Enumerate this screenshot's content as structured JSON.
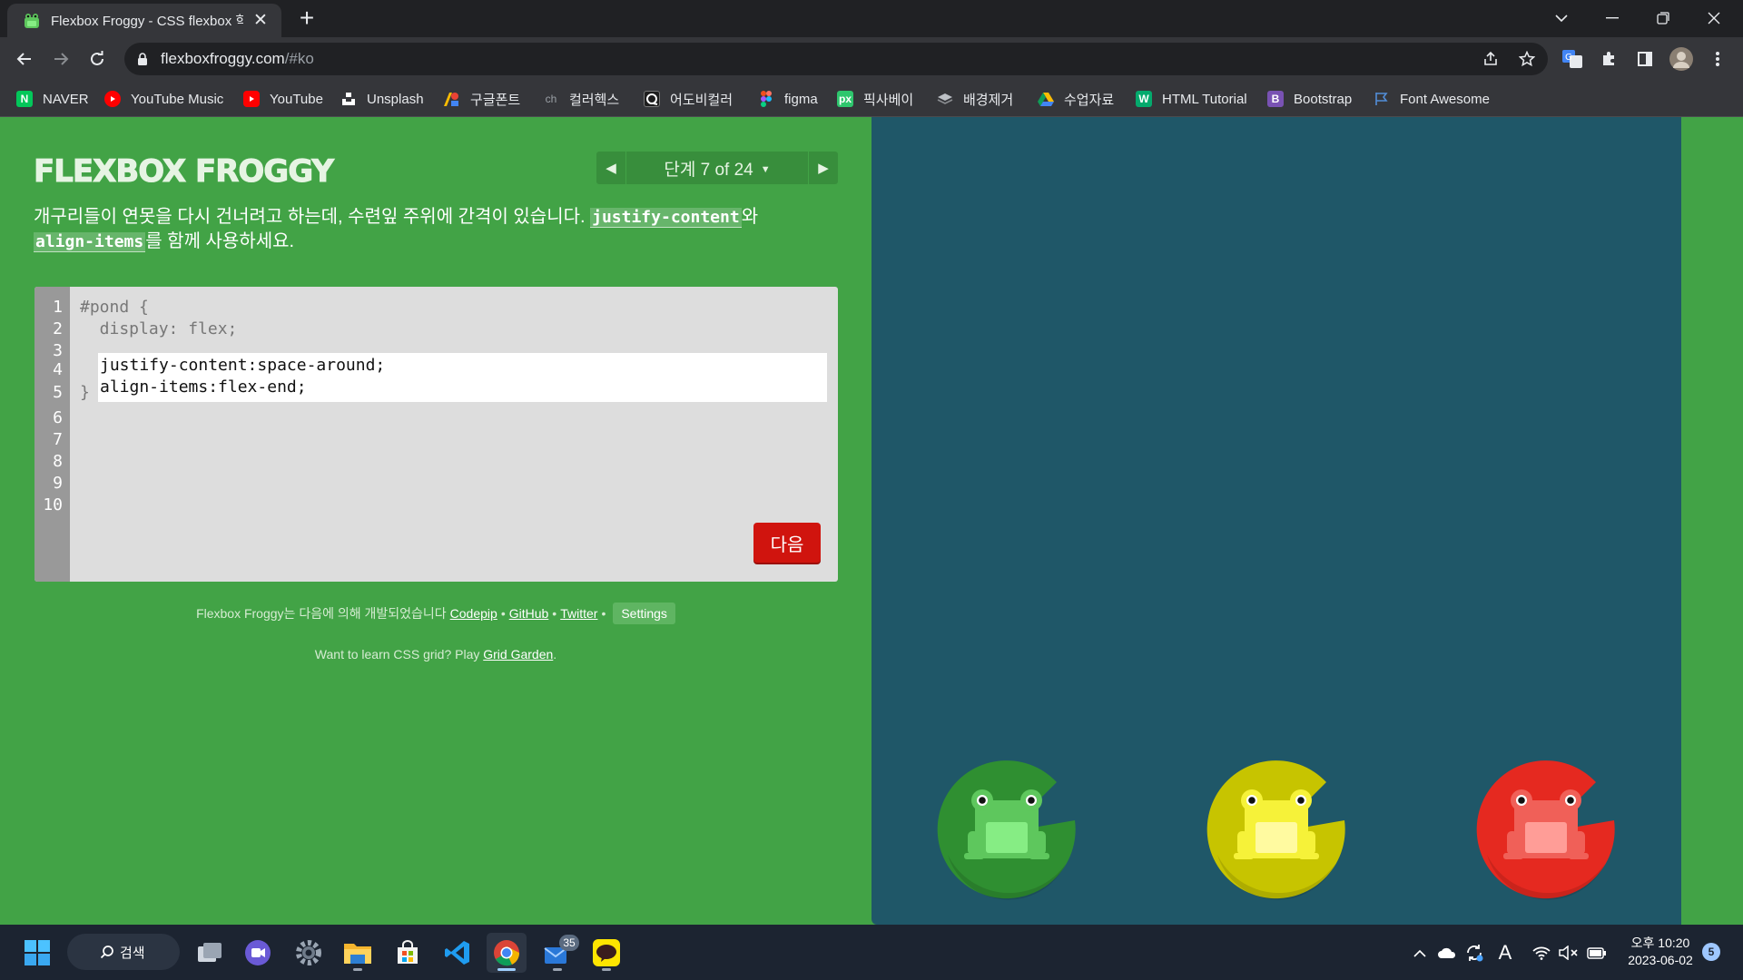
{
  "browser": {
    "tab_title": "Flexbox Froggy - CSS flexbox 학",
    "url_host": "flexboxfroggy.com",
    "url_path": "/#ko",
    "bookmarks": [
      {
        "label": "NAVER",
        "icon": "naver-icon",
        "color": "#03c75a",
        "glyph": "N"
      },
      {
        "label": "YouTube Music",
        "icon": "youtube-music-icon",
        "color": "#ff0000",
        "glyph": ""
      },
      {
        "label": "YouTube",
        "icon": "youtube-icon",
        "color": "#ff0000",
        "glyph": ""
      },
      {
        "label": "Unsplash",
        "icon": "unsplash-icon",
        "color": "#ffffff",
        "glyph": ""
      },
      {
        "label": "구글폰트",
        "icon": "google-fonts-icon",
        "color": "#4285f4",
        "glyph": ""
      },
      {
        "label": "컬러헥스",
        "icon": "colorhex-icon",
        "color": "#35363a",
        "glyph": "ch"
      },
      {
        "label": "어도비컬러",
        "icon": "adobe-color-icon",
        "color": "#1e1e1e",
        "glyph": ""
      },
      {
        "label": "figma",
        "icon": "figma-icon",
        "color": "#f24e1e",
        "glyph": ""
      },
      {
        "label": "픽사베이",
        "icon": "pixabay-icon",
        "color": "#2ec66d",
        "glyph": "px"
      },
      {
        "label": "배경제거",
        "icon": "remove-bg-icon",
        "color": "#9aa0a6",
        "glyph": ""
      },
      {
        "label": "수업자료",
        "icon": "google-drive-icon",
        "color": "#fbbc04",
        "glyph": ""
      },
      {
        "label": "HTML Tutorial",
        "icon": "w3schools-icon",
        "color": "#04aa6d",
        "glyph": "W"
      },
      {
        "label": "Bootstrap",
        "icon": "bootstrap-icon",
        "color": "#7952b3",
        "glyph": "B"
      },
      {
        "label": "Font Awesome",
        "icon": "font-awesome-icon",
        "color": "#528dd7",
        "glyph": ""
      }
    ]
  },
  "game": {
    "logo": "FLEXBOX FROGGY",
    "level_label": "단계 7 of 24",
    "level_current": 7,
    "level_total": 24,
    "instructions_before": "개구리들이 연못을 다시 건너려고 하는데, 수련잎 주위에 간격이 있습니다. ",
    "code_term_1": "justify-content",
    "instructions_mid": "와",
    "code_term_2": "align-items",
    "instructions_after": "를 함께 사용하세요.",
    "line_numbers": [
      "1",
      "2",
      "3",
      "4",
      "5",
      "6",
      "7",
      "8",
      "9",
      "10"
    ],
    "code_line_1": "#pond {",
    "code_line_2": "  display: flex;",
    "code_line_5": "}",
    "user_input": "justify-content:space-around;\nalign-items:flex-end;",
    "next_button": "다음",
    "credits_text": "Flexbox Froggy는 다음에 의해 개발되었습니다",
    "credit_codepip": "Codepip",
    "credit_github": "GitHub",
    "credit_twitter": "Twitter",
    "bullet": "•",
    "settings_button": "Settings",
    "grid_text_before": "Want to learn CSS grid? Play ",
    "grid_link": "Grid Garden",
    "grid_text_after": "."
  },
  "pond": {
    "background": "#1f5768",
    "frogs": [
      {
        "color": "green",
        "pad": "#2f8f31",
        "body": "#5ec75d",
        "belly": "#86ed84"
      },
      {
        "color": "yellow",
        "pad": "#c7c400",
        "body": "#f6f239",
        "belly": "#fffaa0"
      },
      {
        "color": "red",
        "pad": "#e52920",
        "body": "#f06058",
        "belly": "#ff9d97"
      }
    ]
  },
  "taskbar": {
    "search_label": "검색",
    "mail_badge": "35",
    "clock_time": "오후 10:20",
    "clock_date": "2023-06-02",
    "notification_count": "5"
  },
  "colors": {
    "page_green": "#42a346",
    "next_red": "#d0140e",
    "editor_gray": "#dddddd"
  }
}
